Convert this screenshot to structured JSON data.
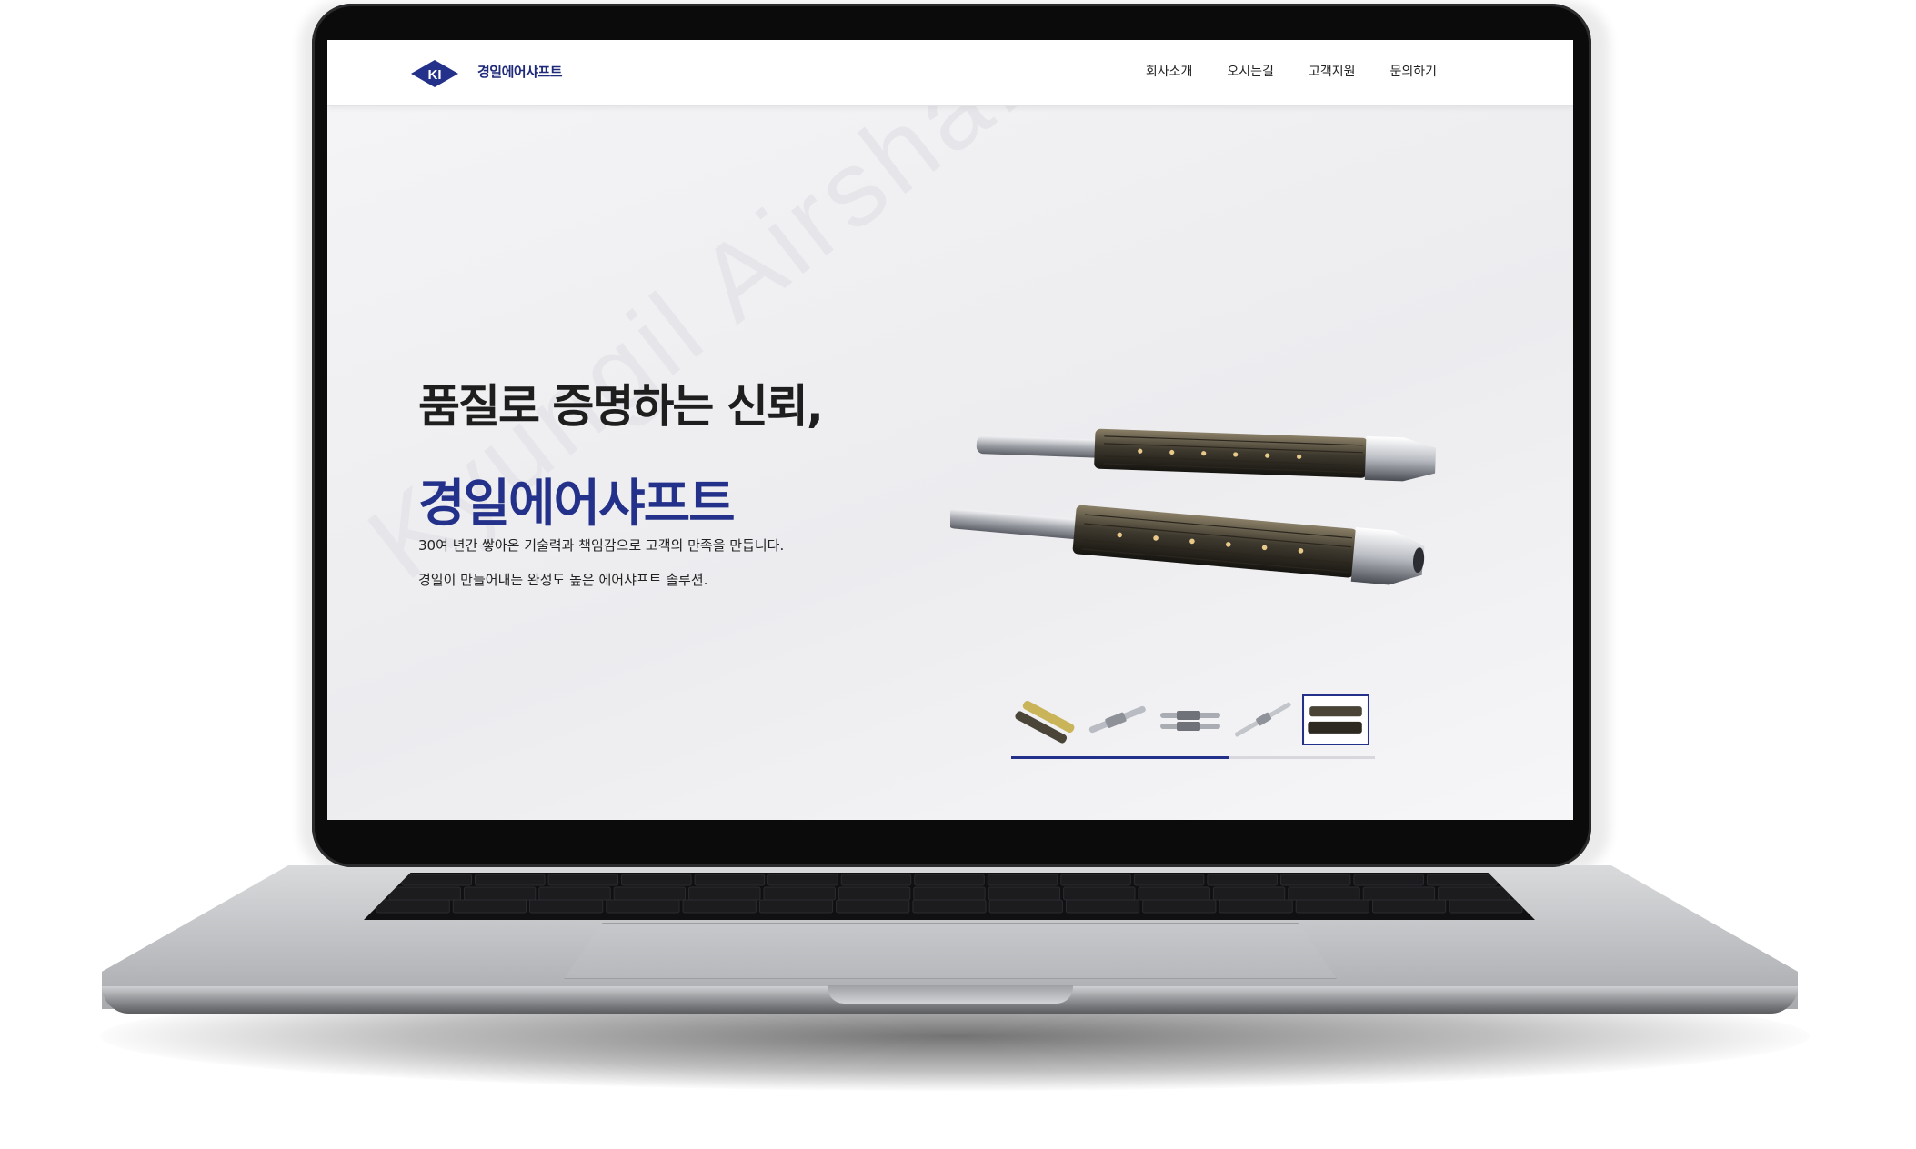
{
  "site": {
    "brand_name": "경일에어샤프트",
    "logo_letters": "KI"
  },
  "nav": {
    "items": [
      {
        "label": "회사소개"
      },
      {
        "label": "오시는길"
      },
      {
        "label": "고객지원"
      },
      {
        "label": "문의하기"
      }
    ]
  },
  "hero": {
    "headline": "품질로 증명하는 신뢰,",
    "brand": "경일에어샤프트",
    "desc_line1": "30여 년간 쌓아온 기술력과 책임감으로 고객의 만족을 만듭니다.",
    "desc_line2": "경일이 만들어내는 완성도 높은 에어샤프트 솔루션.",
    "watermark": "Kyungil Airshaft"
  },
  "slider": {
    "thumbnail_count": 5,
    "active_index": 4,
    "progress_fraction": 0.6
  },
  "colors": {
    "brand_navy": "#23318a",
    "text_dark": "#1e1e1e",
    "hero_bg": "#f1f1f3"
  }
}
